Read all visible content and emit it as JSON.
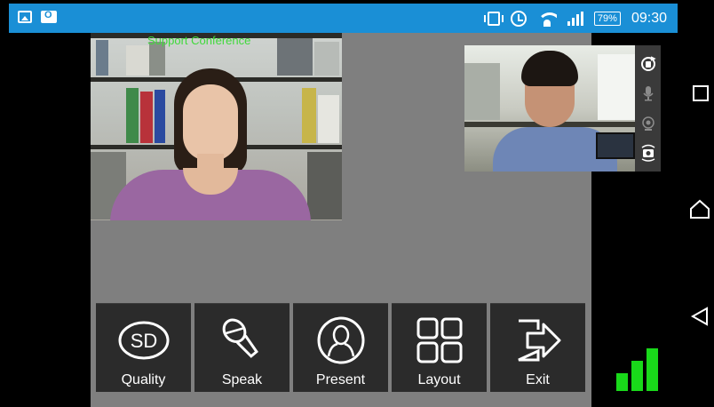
{
  "status_bar": {
    "battery": "79%",
    "time": "09:30",
    "left_icons": [
      "gallery-icon",
      "outlook-icon"
    ],
    "right_icons": [
      "vibrate-icon",
      "alarm-icon",
      "wifi-icon",
      "cell-signal-icon",
      "battery-icon"
    ],
    "background_color": "#1a8fd6"
  },
  "conference": {
    "main_video_label": "Support Conference",
    "label_color": "#3fd93a"
  },
  "camera_controls": [
    "rotate-camera-icon",
    "microphone-icon",
    "camera-icon",
    "switch-camera-icon"
  ],
  "toolbar": [
    {
      "label": "Quality",
      "icon": "sd-quality-icon",
      "glyph_text": "SD"
    },
    {
      "label": "Speak",
      "icon": "microphone-icon"
    },
    {
      "label": "Present",
      "icon": "presenter-icon"
    },
    {
      "label": "Layout",
      "icon": "layout-grid-icon"
    },
    {
      "label": "Exit",
      "icon": "exit-arrow-icon"
    }
  ],
  "connection_strength": {
    "level": 3,
    "max": 3,
    "color": "#19d91a"
  },
  "nav_bar": [
    "recents-button",
    "home-button",
    "back-button"
  ]
}
